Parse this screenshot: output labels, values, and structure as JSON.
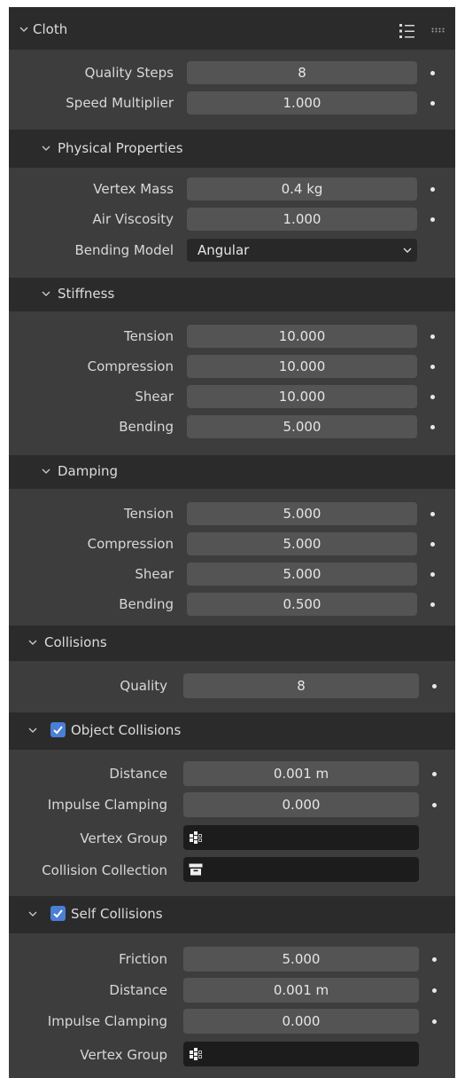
{
  "panel": {
    "title": "Cloth",
    "header_icons": [
      "list-icon",
      "drag-grip-icon"
    ],
    "quality_steps": {
      "label": "Quality Steps",
      "value": "8"
    },
    "speed_multiplier": {
      "label": "Speed Multiplier",
      "value": "1.000"
    }
  },
  "physical": {
    "title": "Physical Properties",
    "vertex_mass": {
      "label": "Vertex Mass",
      "value": "0.4 kg"
    },
    "air_viscosity": {
      "label": "Air Viscosity",
      "value": "1.000"
    },
    "bending_model": {
      "label": "Bending Model",
      "value": "Angular"
    }
  },
  "stiffness": {
    "title": "Stiffness",
    "tension": {
      "label": "Tension",
      "value": "10.000"
    },
    "compression": {
      "label": "Compression",
      "value": "10.000"
    },
    "shear": {
      "label": "Shear",
      "value": "10.000"
    },
    "bending": {
      "label": "Bending",
      "value": "5.000"
    }
  },
  "damping": {
    "title": "Damping",
    "tension": {
      "label": "Tension",
      "value": "5.000"
    },
    "compression": {
      "label": "Compression",
      "value": "5.000"
    },
    "shear": {
      "label": "Shear",
      "value": "5.000"
    },
    "bending": {
      "label": "Bending",
      "value": "0.500"
    }
  },
  "collisions": {
    "title": "Collisions",
    "quality": {
      "label": "Quality",
      "value": "8"
    }
  },
  "object_collisions": {
    "title": "Object Collisions",
    "enabled": true,
    "distance": {
      "label": "Distance",
      "value": "0.001 m"
    },
    "impulse_clamping": {
      "label": "Impulse Clamping",
      "value": "0.000"
    },
    "vertex_group": {
      "label": "Vertex Group",
      "value": ""
    },
    "collision_collection": {
      "label": "Collision Collection",
      "value": ""
    }
  },
  "self_collisions": {
    "title": "Self Collisions",
    "enabled": true,
    "friction": {
      "label": "Friction",
      "value": "5.000"
    },
    "distance": {
      "label": "Distance",
      "value": "0.001 m"
    },
    "impulse_clamping": {
      "label": "Impulse Clamping",
      "value": "0.000"
    },
    "vertex_group": {
      "label": "Vertex Group",
      "value": ""
    }
  },
  "colors": {
    "panel_bg": "#3d3d3d",
    "header_bg": "#2b2b2b",
    "field_bg": "#545454",
    "checkbox": "#4a7fd6"
  }
}
